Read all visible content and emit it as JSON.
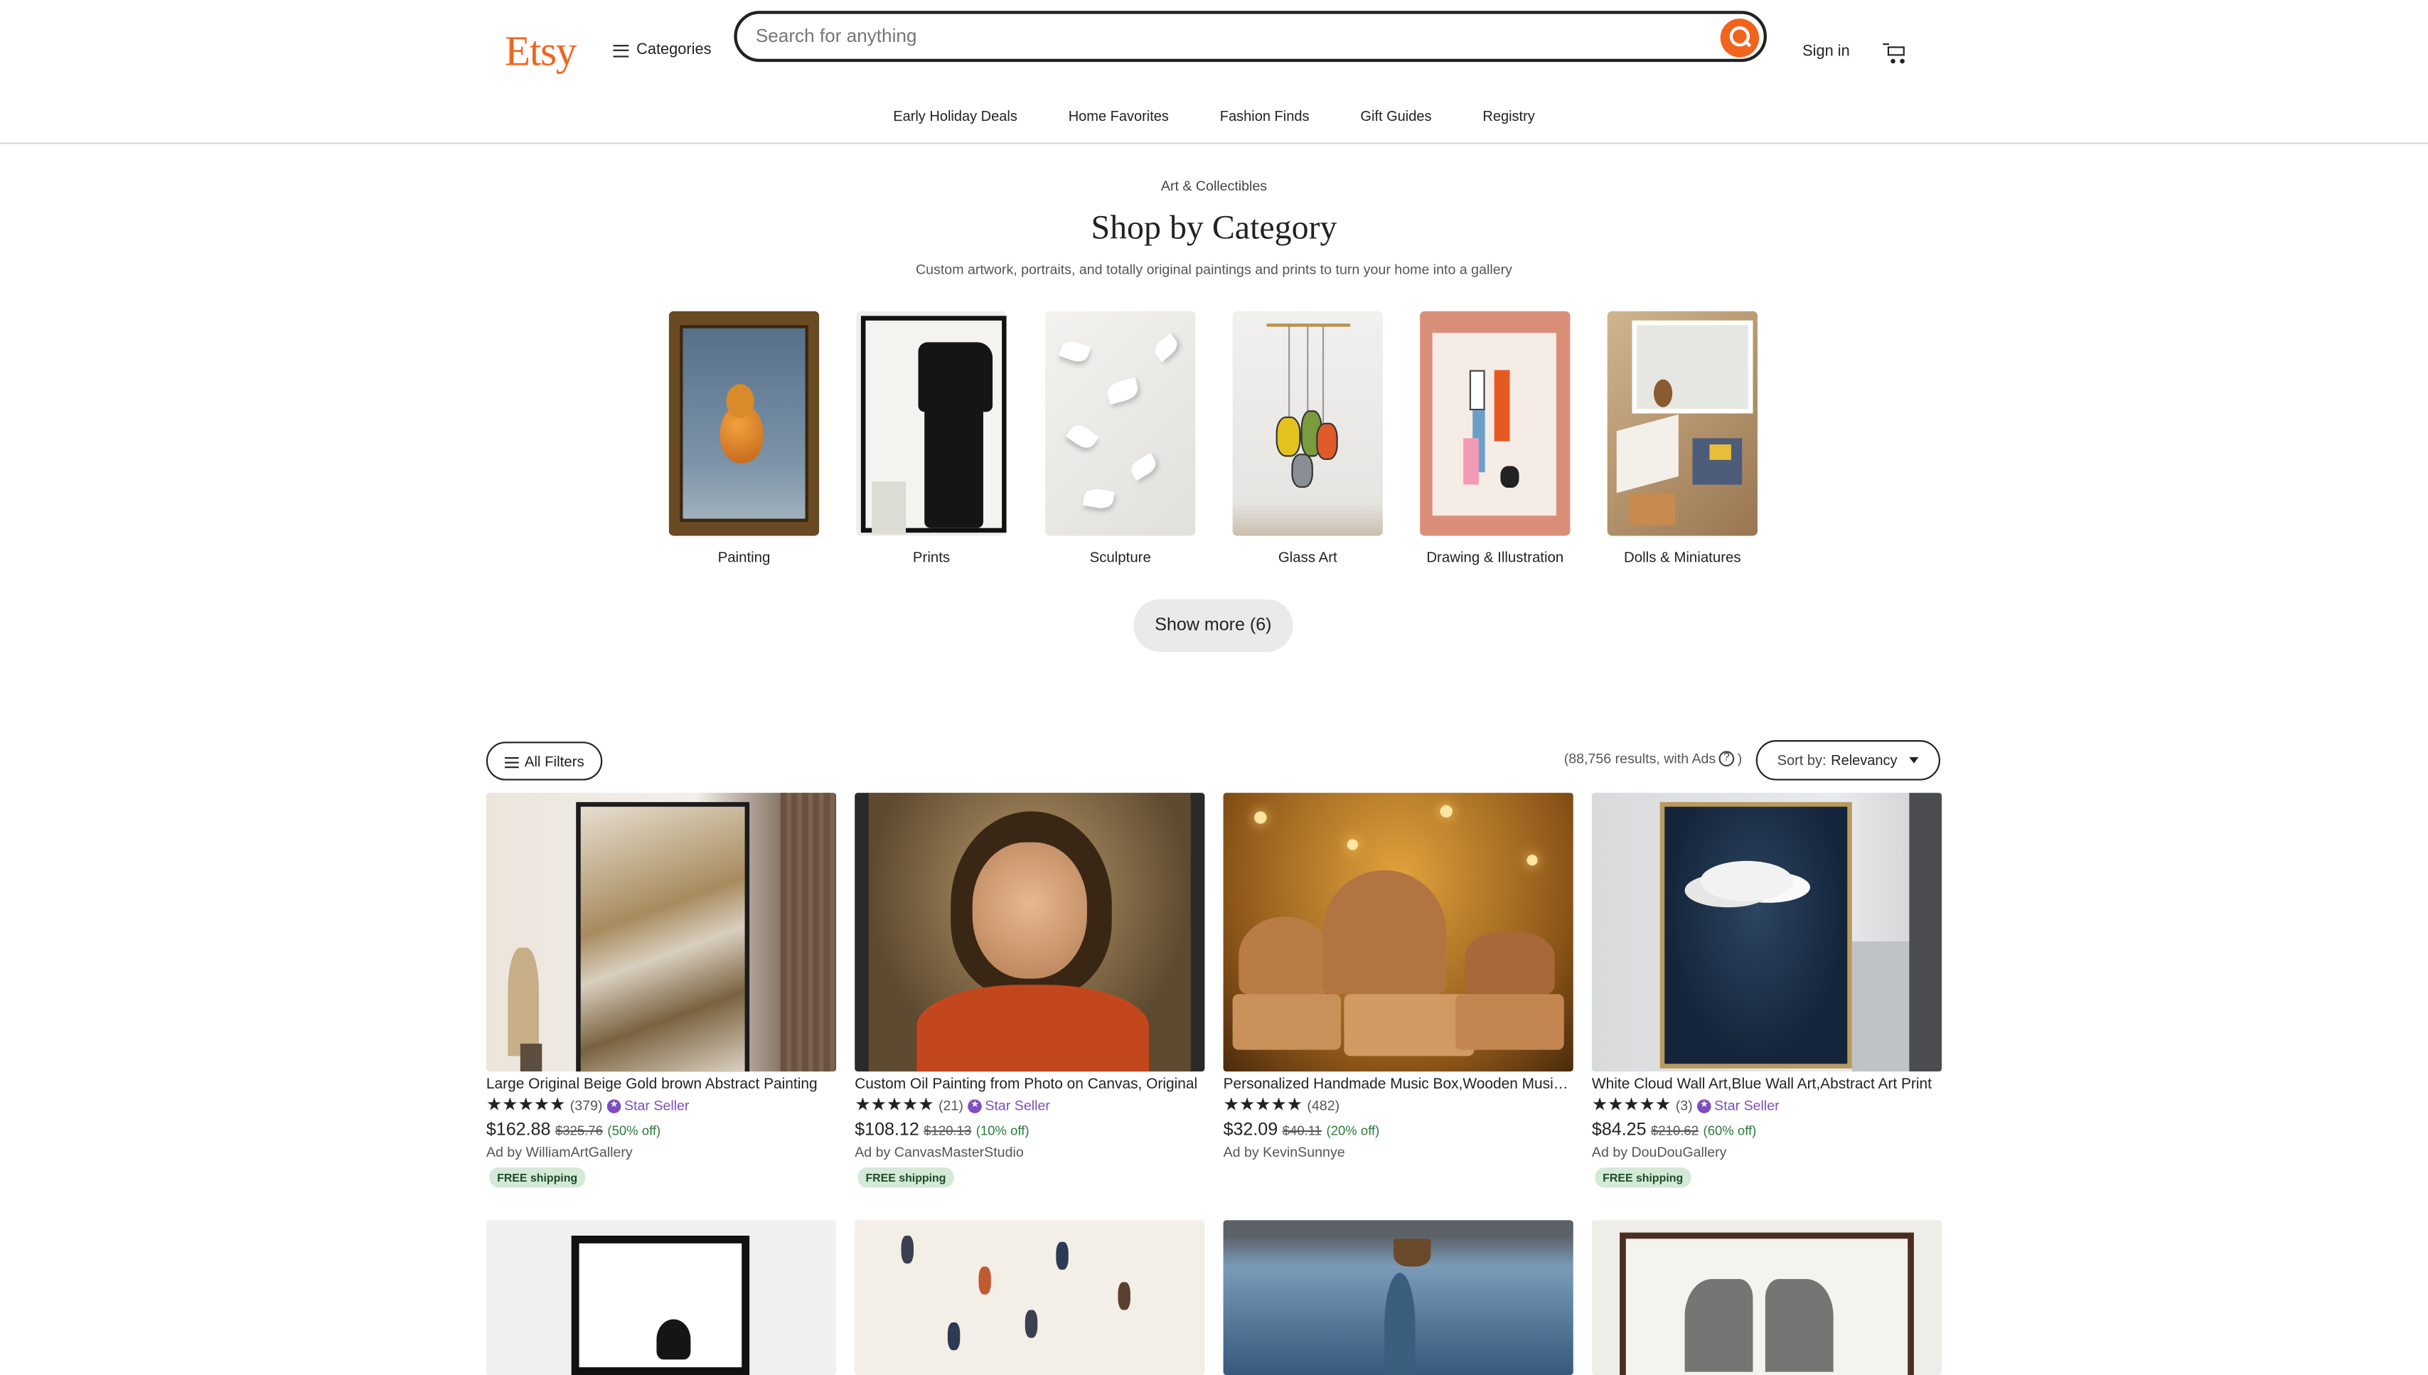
{
  "header": {
    "logo": "Etsy",
    "categories_label": "Categories",
    "search_placeholder": "Search for anything",
    "signin_label": "Sign in"
  },
  "nav": [
    "Early Holiday Deals",
    "Home Favorites",
    "Fashion Finds",
    "Gift Guides",
    "Registry"
  ],
  "section": {
    "breadcrumb": "Art & Collectibles",
    "title": "Shop by Category",
    "subtitle": "Custom artwork, portraits, and totally original paintings and prints to turn your home into a gallery",
    "categories": [
      "Painting",
      "Prints",
      "Sculpture",
      "Glass Art",
      "Drawing & Illustration",
      "Dolls & Miniatures"
    ],
    "show_more": "Show more (6)"
  },
  "toolbar": {
    "filters_label": "All Filters",
    "results_text": "(88,756 results, with Ads",
    "results_close": ")",
    "sort_prefix": "Sort by:",
    "sort_value": "Relevancy"
  },
  "listings": [
    {
      "title": "Large Original Beige Gold brown Abstract Painting",
      "reviews": "(379)",
      "star_seller": "Star Seller",
      "price": "$162.88",
      "old_price": "$325.76",
      "discount": "(50% off)",
      "shop": "Ad by WilliamArtGallery",
      "shipping": "FREE shipping"
    },
    {
      "title": "Custom Oil Painting from Photo on Canvas, Original",
      "reviews": "(21)",
      "star_seller": "Star Seller",
      "price": "$108.12",
      "old_price": "$120.13",
      "discount": "(10% off)",
      "shop": "Ad by CanvasMasterStudio",
      "shipping": "FREE shipping"
    },
    {
      "title": "Personalized Handmade Music Box,Wooden Music Box",
      "reviews": "(482)",
      "star_seller": "",
      "price": "$32.09",
      "old_price": "$40.11",
      "discount": "(20% off)",
      "shop": "Ad by KevinSunnye",
      "shipping": ""
    },
    {
      "title": "White Cloud Wall Art,Blue Wall Art,Abstract Art Print",
      "reviews": "(3)",
      "star_seller": "Star Seller",
      "price": "$84.25",
      "old_price": "$210.62",
      "discount": "(60% off)",
      "shop": "Ad by DouDouGallery",
      "shipping": "FREE shipping"
    }
  ],
  "colors": {
    "brand": "#f1641e",
    "star_seller": "#7e4ec0",
    "free_shipping_bg": "#d4e9d7"
  }
}
